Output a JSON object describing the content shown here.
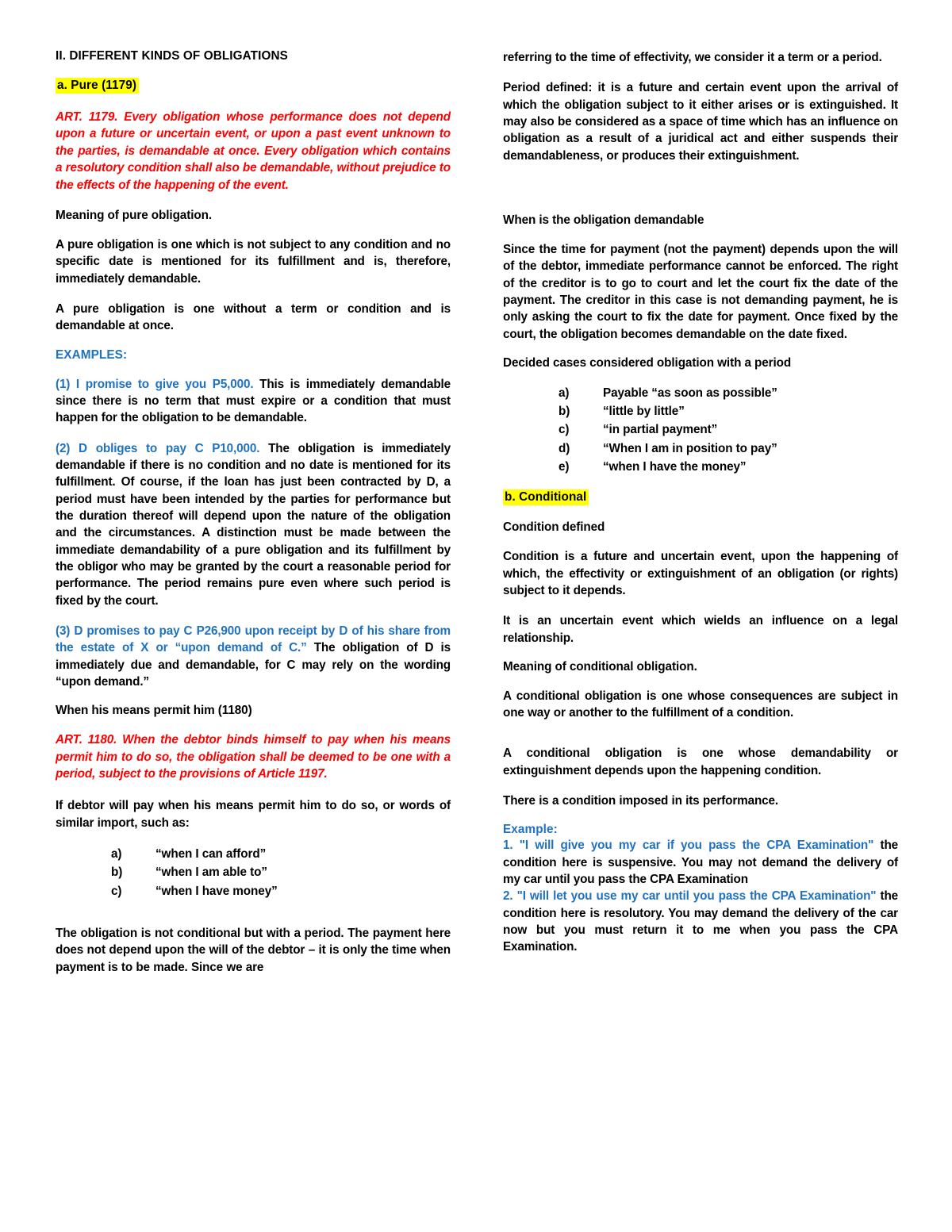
{
  "document": {
    "section_title": "II. DIFFERENT KINDS OF OBLIGATIONS",
    "colors": {
      "highlight": "#FFFF00",
      "article_red": "#FF0000",
      "accent_blue": "#2072BF",
      "body_text": "#000000",
      "page_background": "#FFFFFF"
    }
  },
  "left_column": {
    "heading_a": "a.   Pure (1179)",
    "art_1179": "ART. 1179. Every obligation whose performance does not depend upon a future or uncertain event, or upon a past event unknown to the parties, is demandable at once. Every obligation which contains a resolutory condition shall also be demandable, without prejudice to the effects of the happening of the event.",
    "meaning_heading": "Meaning of pure obligation.",
    "para_1": "A pure obligation is one which is not subject to any condition and no specific date is mentioned for its fulfillment and is, therefore, immediately demandable.",
    "para_2": "A pure obligation is one without a term or condition and is demandable at once.",
    "examples_heading": "EXAMPLES:",
    "example_1_blue": "(1) I promise to give you P5,000.",
    "example_1_rest": " This is immediately demandable since there is no term that must expire or a condition that must happen for the obligation to be demandable.",
    "example_2_blue": "(2) D obliges to pay C P10,000.",
    "example_2_rest": " The obligation is immediately demandable if there is no condition and no date is mentioned for its fulfillment. Of course, if the loan has just been contracted by D, a period must have been intended by the parties for performance but the duration thereof will depend upon the nature of the obligation and the circumstances. A distinction must be made between the immediate demandability of a pure obligation and its fulfillment by the obligor who may be granted by the court a reasonable period for performance. The period remains pure even where such period is fixed by the court.",
    "example_3_blue": "(3) D promises to pay C P26,900 upon receipt by D of his share from the estate of X or “upon demand of C.”",
    "example_3_rest": " The obligation of D is immediately due and demandable, for C may rely on the wording “upon demand.”",
    "means_permit_heading": "When his means permit him (1180)",
    "art_1180": "ART. 1180. When the debtor binds himself to pay when his means permit him to do so, the obligation shall be deemed to be one with a period, subject to the provisions of Article 1197.",
    "if_debtor_para": "If debtor will pay when his means permit him to do so, or words of similar import, such as:",
    "means_list": [
      {
        "marker": "a)",
        "text": "“when I can afford”"
      },
      {
        "marker": "b)",
        "text": "“when I am able to”"
      },
      {
        "marker": "c)",
        "text": "“when I have money”"
      }
    ],
    "closing_para": "The obligation is not conditional but with a period. The payment here does not depend upon the will of the debtor – it is only the time when payment is to be made. Since we are"
  },
  "right_column": {
    "continuation_para": "referring to the time of effectivity, we consider it a term or a period.",
    "period_defined_para": "Period defined: it is a future and certain event upon the arrival of which the obligation subject to it either arises or is extinguished. It may also be considered as a space of time which has an influence on obligation as a result of a juridical act and either suspends their demandableness, or produces their extinguishment.",
    "demandable_heading": "When is the obligation demandable",
    "demandable_para": "Since the time for payment (not the payment) depends upon the will of the debtor, immediate performance cannot be enforced. The right of the creditor is to go to court and let the court fix the date of the payment. The creditor in this case is not demanding payment, he is only asking the court to fix the date for payment. Once fixed by the court, the obligation becomes demandable on the date fixed.",
    "decided_cases_heading": "Decided cases considered obligation with a period",
    "decided_cases_list": [
      {
        "marker": "a)",
        "text": "Payable “as soon as possible”"
      },
      {
        "marker": "b)",
        "text": "“little by little”"
      },
      {
        "marker": "c)",
        "text": "“in partial payment”"
      },
      {
        "marker": "d)",
        "text": "“When I am in position to pay”"
      },
      {
        "marker": "e)",
        "text": "“when I have the money”"
      }
    ],
    "heading_b": "b.   Conditional",
    "condition_defined_heading": "Condition defined",
    "condition_para_1": "Condition is a future and uncertain event, upon the happening of which, the effectivity or extinguishment of an obligation (or rights) subject to it depends.",
    "condition_para_2": "It is an uncertain event which wields an influence on a legal relationship.",
    "meaning_conditional_heading": "Meaning of conditional obligation.",
    "conditional_para_1": "A conditional obligation is one whose consequences are subject in one way or another to the fulfillment of a condition.",
    "conditional_para_2": "A conditional obligation is one whose demandability or extinguishment depends upon the happening condition.",
    "conditional_para_3": "There is a condition imposed in its performance.",
    "example_heading": "Example:",
    "example_1_blue": "1. \"I will give you my car if you pass the CPA Examination\"",
    "example_1_rest": " the condition here is suspensive. You may not demand the delivery of my car until you pass the CPA Examination",
    "example_2_blue": "2. \"I will let you use my car until you pass the CPA Examination\"",
    "example_2_rest": " the condition here is resolutory. You may demand the delivery of the car now but you must return it to me when you pass the CPA Examination."
  }
}
